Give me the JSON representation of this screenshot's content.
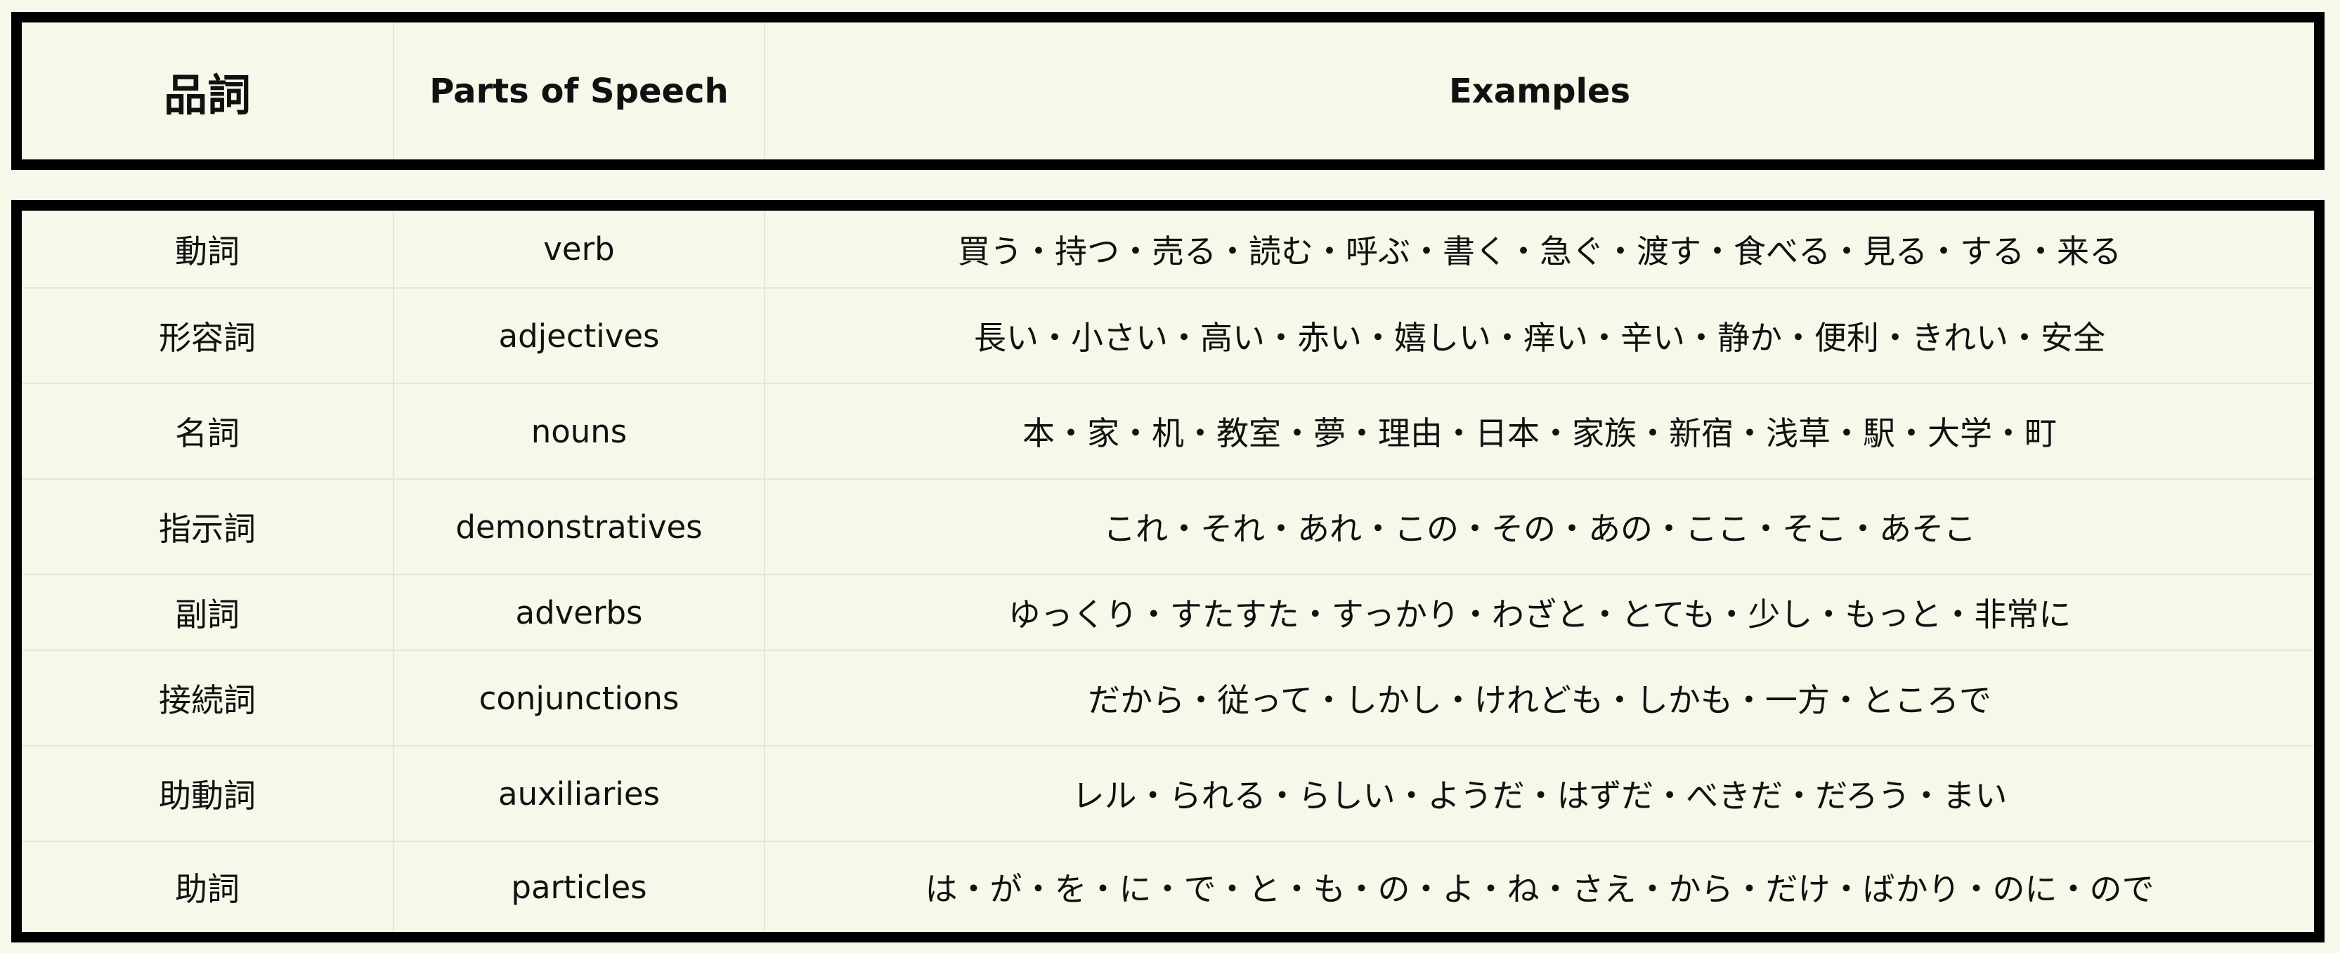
{
  "header": {
    "col_japanese": "品詞",
    "col_parts": "Parts of Speech",
    "col_examples": "Examples"
  },
  "rows": [
    {
      "jp": "動詞",
      "en": "verb",
      "examples": "買う・持つ・売る・読む・呼ぶ・書く・急ぐ・渡す・食べる・見る・する・来る"
    },
    {
      "jp": "形容詞",
      "en": "adjectives",
      "examples": "長い・小さい・高い・赤い・嬉しい・痒い・辛い・静か・便利・きれい・安全"
    },
    {
      "jp": "名詞",
      "en": "nouns",
      "examples": "本・家・机・教室・夢・理由・日本・家族・新宿・浅草・駅・大学・町"
    },
    {
      "jp": "指示詞",
      "en": "demonstratives",
      "examples": "これ・それ・あれ・この・その・あの・ここ・そこ・あそこ"
    },
    {
      "jp": "副詞",
      "en": "adverbs",
      "examples": "ゆっくり・すたすた・すっかり・わざと・とても・少し・もっと・非常に"
    },
    {
      "jp": "接続詞",
      "en": "conjunctions",
      "examples": "だから・従って・しかし・けれども・しかも・一方・ところで"
    },
    {
      "jp": "助動詞",
      "en": "auxiliaries",
      "examples": "レル・られる・らしい・ようだ・はずだ・べきだ・だろう・まい"
    },
    {
      "jp": "助詞",
      "en": "particles",
      "examples": "は・が・を・に・で・と・も・の・よ・ね・さえ・から・だけ・ばかり・のに・ので"
    }
  ]
}
